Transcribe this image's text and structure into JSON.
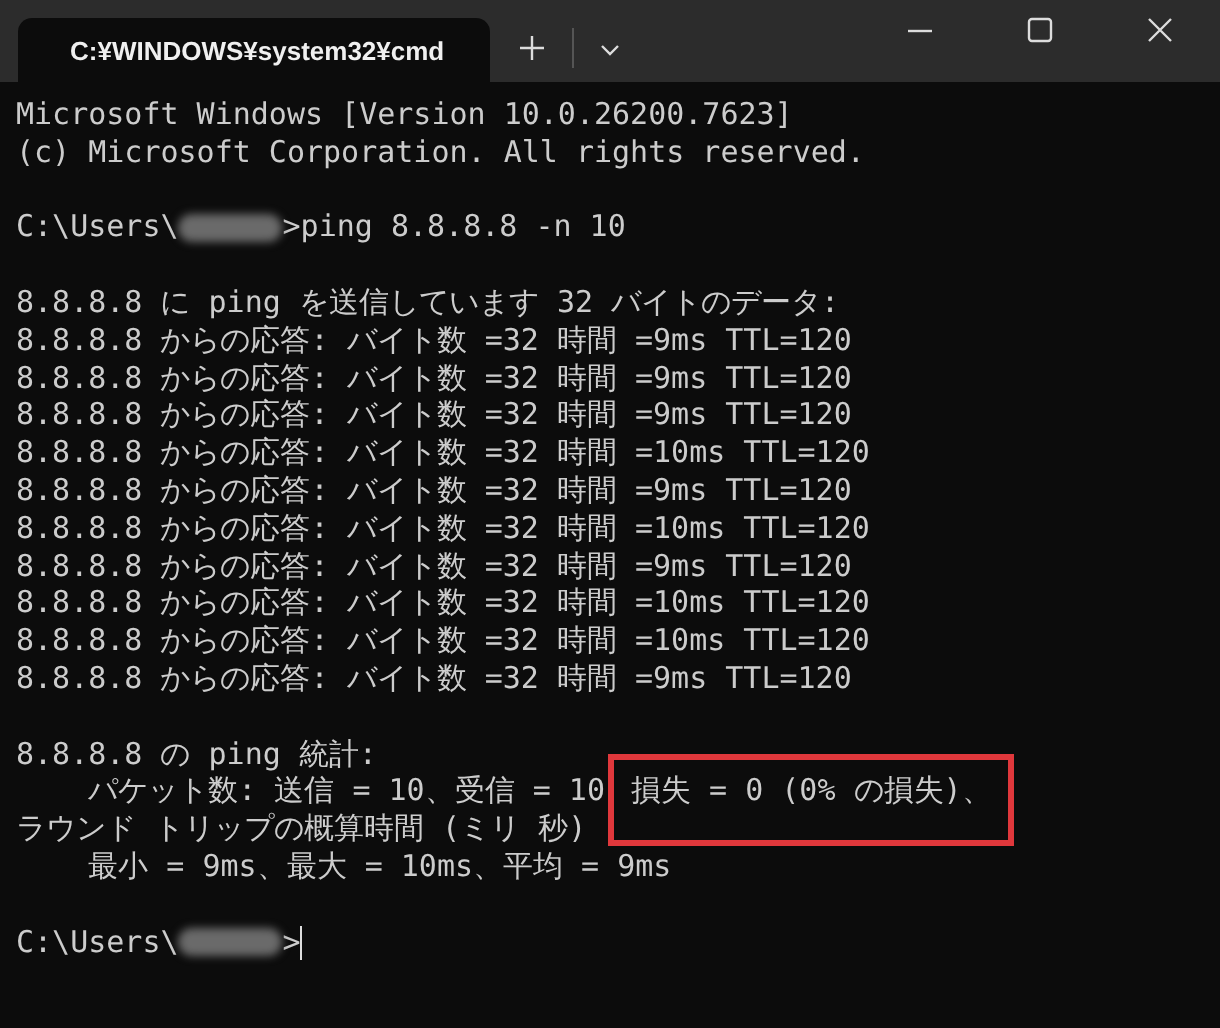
{
  "window": {
    "tab_title": "C:¥WINDOWS¥system32¥cmd"
  },
  "blocks": [
    [
      {
        "kind": "text",
        "indent": false,
        "text": "Microsoft Windows [Version 10.0.26200.7623]"
      },
      {
        "kind": "text",
        "indent": false,
        "text": "(c) Microsoft Corporation. All rights reserved."
      }
    ],
    [
      {
        "kind": "prompt",
        "path": "C:\\Users\\",
        "command": ">ping 8.8.8.8 -n 10",
        "cursor": false
      }
    ],
    [
      {
        "kind": "text",
        "indent": false,
        "text": "8.8.8.8 に ping を送信しています 32 バイトのデータ:"
      },
      {
        "kind": "text",
        "indent": false,
        "text": "8.8.8.8 からの応答: バイト数 =32 時間 =9ms TTL=120"
      },
      {
        "kind": "text",
        "indent": false,
        "text": "8.8.8.8 からの応答: バイト数 =32 時間 =9ms TTL=120"
      },
      {
        "kind": "text",
        "indent": false,
        "text": "8.8.8.8 からの応答: バイト数 =32 時間 =9ms TTL=120"
      },
      {
        "kind": "text",
        "indent": false,
        "text": "8.8.8.8 からの応答: バイト数 =32 時間 =10ms TTL=120"
      },
      {
        "kind": "text",
        "indent": false,
        "text": "8.8.8.8 からの応答: バイト数 =32 時間 =9ms TTL=120"
      },
      {
        "kind": "text",
        "indent": false,
        "text": "8.8.8.8 からの応答: バイト数 =32 時間 =10ms TTL=120"
      },
      {
        "kind": "text",
        "indent": false,
        "text": "8.8.8.8 からの応答: バイト数 =32 時間 =9ms TTL=120"
      },
      {
        "kind": "text",
        "indent": false,
        "text": "8.8.8.8 からの応答: バイト数 =32 時間 =10ms TTL=120"
      },
      {
        "kind": "text",
        "indent": false,
        "text": "8.8.8.8 からの応答: バイト数 =32 時間 =10ms TTL=120"
      },
      {
        "kind": "text",
        "indent": false,
        "text": "8.8.8.8 からの応答: バイト数 =32 時間 =9ms TTL=120"
      }
    ],
    [
      {
        "kind": "text",
        "indent": false,
        "text": "8.8.8.8 の ping 統計:"
      },
      {
        "kind": "highlight",
        "indent": true,
        "text": "パケット数: 送信 = 10、受信 = 10",
        "marked": "損失 = 0 (0% の損失)、"
      },
      {
        "kind": "text",
        "indent": false,
        "text": "ラウンド トリップの概算時間 (ミリ 秒)"
      },
      {
        "kind": "text",
        "indent": true,
        "text": "最小 = 9ms、最大 = 10ms、平均 = 9ms"
      }
    ],
    [
      {
        "kind": "prompt",
        "path": "C:\\Users\\",
        "command": ">",
        "cursor": true
      }
    ]
  ]
}
